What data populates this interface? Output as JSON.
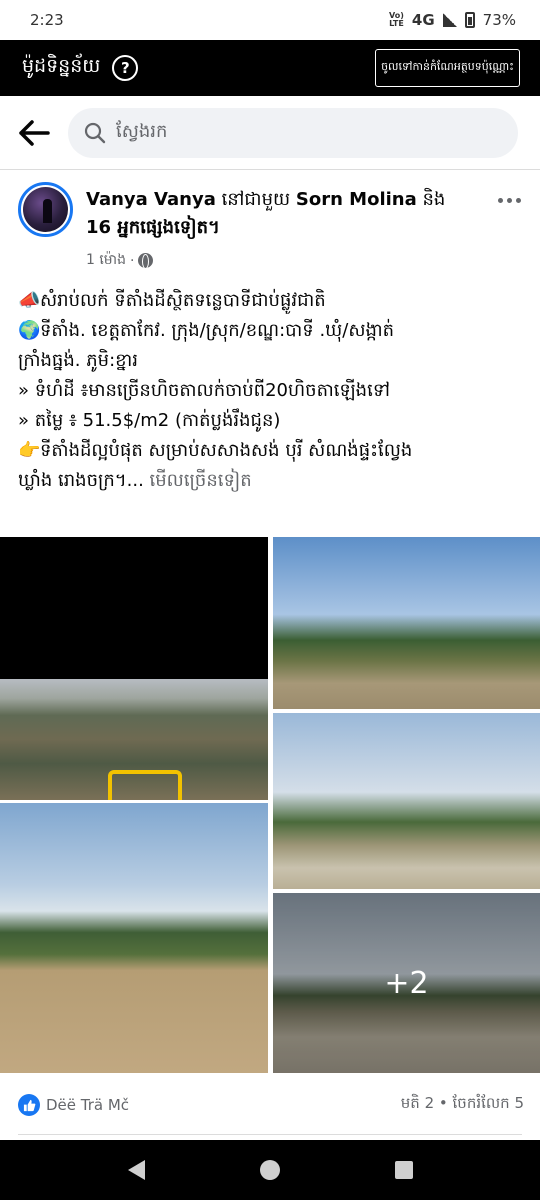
{
  "status_bar": {
    "time": "2:23",
    "volte_top": "Vo)",
    "volte_bottom": "LTE",
    "network": "4G",
    "battery": "73%"
  },
  "data_mode_bar": {
    "title": "ម៉ូដទិន្នន័យ",
    "upgrade_label": "ចូលទៅកាន់កំណែអត្ថបទប៉ុណ្ណោះ"
  },
  "search": {
    "placeholder": "ស្វែងរក"
  },
  "post": {
    "author": "Vanya Vanya",
    "with_word": "នៅជាមួយ",
    "tagged": "Sorn Molina",
    "and_word": "និង",
    "others": "16 អ្នកផ្សេងទៀត",
    "time": "1 ម៉ោង",
    "lines": [
      {
        "emoji": "📣",
        "text": "សំរាប់លក់ ទីតាំងដីស្ថិតទន្លេបាទីជាប់ផ្លូវជាតិ"
      },
      {
        "emoji": "🌍",
        "text": "ទីតាំង. ខេត្តតាកែវ. ក្រុង/ស្រុក/ខណ្ឌ:បាទី .ឃុំ/សង្កាត់"
      },
      {
        "emoji": "",
        "text": "ក្រាំងធ្នង់. ភូមិ:ខ្នារ"
      },
      {
        "emoji": "",
        "text": "» ទំហំដី ៖មានច្រើនហិចតាលក់ចាប់ពី20ហិចតាឡើងទៅ"
      },
      {
        "emoji": "",
        "text": "» តម្លៃ ៖ 51.5$/m2 (កាត់ប្លង់រឹងជូន)"
      },
      {
        "emoji": "👉",
        "text": "ទីតាំងដីល្អបំផុត សម្រាប់សសាងសង់ បុរី សំណង់ផ្ទះល្វែង"
      },
      {
        "emoji": "",
        "text": "ឃ្លាំង រោងចក្រ។..."
      }
    ],
    "see_more": "មើលច្រើនទៀត",
    "extra_photos": "+2",
    "reaction_name": "Dëë Trä Mč",
    "likes": "មតិ 2",
    "shares": "ចែករំលែក 5",
    "separator": "•"
  }
}
